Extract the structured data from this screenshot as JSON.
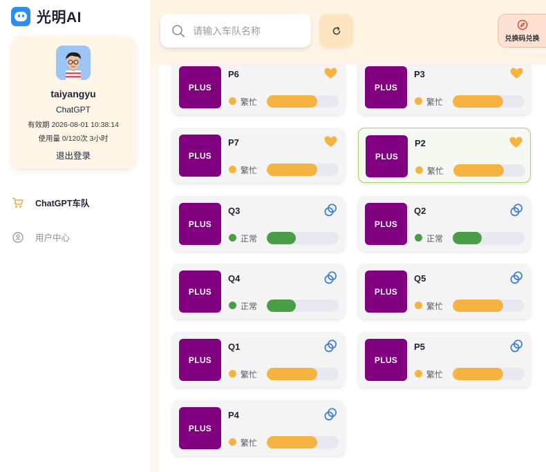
{
  "app": {
    "brand": "光明AI"
  },
  "user": {
    "name": "taiyangyu",
    "plan": "ChatGPT",
    "expire": "有效期 2026-08-01 10:38:14",
    "usage": "使用量 0/120次 3小时",
    "logout_label": "退出登录"
  },
  "nav": {
    "items": [
      {
        "label": "ChatGPT车队",
        "icon": "cart-icon",
        "active": true
      },
      {
        "label": "用户中心",
        "icon": "user-center-icon",
        "active": false
      }
    ]
  },
  "header": {
    "search_placeholder": "请输入车队名称",
    "redeem_label": "兑换码兑换"
  },
  "colors": {
    "plus_badge": "#800080",
    "busy": "#f5b342",
    "normal": "#4a9e46",
    "track": "#e8e9f0",
    "heart": "#f5b342",
    "link_icon": "#3b7bd8",
    "selected_border": "#a7d36b"
  },
  "teams": [
    {
      "badge": "PLUS",
      "name": "P6",
      "status": "繁忙",
      "status_type": "busy",
      "load": 0.7,
      "icon": "heart-icon",
      "selected": false
    },
    {
      "badge": "PLUS",
      "name": "P3",
      "status": "繁忙",
      "status_type": "busy",
      "load": 0.7,
      "icon": "heart-icon",
      "selected": false
    },
    {
      "badge": "PLUS",
      "name": "P7",
      "status": "繁忙",
      "status_type": "busy",
      "load": 0.7,
      "icon": "heart-icon",
      "selected": false
    },
    {
      "badge": "PLUS",
      "name": "P2",
      "status": "繁忙",
      "status_type": "busy",
      "load": 0.7,
      "icon": "heart-icon",
      "selected": true
    },
    {
      "badge": "PLUS",
      "name": "Q3",
      "status": "正常",
      "status_type": "normal",
      "load": 0.4,
      "icon": "link-icon",
      "selected": false
    },
    {
      "badge": "PLUS",
      "name": "Q2",
      "status": "正常",
      "status_type": "normal",
      "load": 0.4,
      "icon": "link-icon",
      "selected": false
    },
    {
      "badge": "PLUS",
      "name": "Q4",
      "status": "正常",
      "status_type": "normal",
      "load": 0.4,
      "icon": "link-icon",
      "selected": false
    },
    {
      "badge": "PLUS",
      "name": "Q5",
      "status": "繁忙",
      "status_type": "busy",
      "load": 0.7,
      "icon": "link-icon",
      "selected": false
    },
    {
      "badge": "PLUS",
      "name": "Q1",
      "status": "繁忙",
      "status_type": "busy",
      "load": 0.7,
      "icon": "link-icon",
      "selected": false
    },
    {
      "badge": "PLUS",
      "name": "P5",
      "status": "繁忙",
      "status_type": "busy",
      "load": 0.7,
      "icon": "link-icon",
      "selected": false
    },
    {
      "badge": "PLUS",
      "name": "P4",
      "status": "繁忙",
      "status_type": "busy",
      "load": 0.7,
      "icon": "link-icon",
      "selected": false
    }
  ]
}
